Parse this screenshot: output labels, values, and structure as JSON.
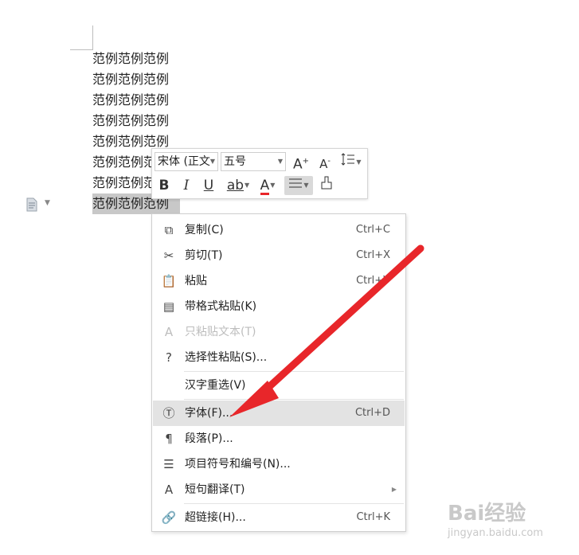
{
  "document": {
    "lines": [
      "范例范例范例",
      "范例范例范例",
      "范例范例范例",
      "范例范例范例",
      "范例范例范例",
      "范例范例范",
      "范例范例范",
      "范例范例范例"
    ]
  },
  "toolbar": {
    "font_name": "宋体 (正文",
    "font_size": "五号",
    "grow_font": "A",
    "shrink_font": "A",
    "bold": "B",
    "italic": "I",
    "underline": "U",
    "highlight": "ab",
    "font_color": "A"
  },
  "menu": {
    "copy": {
      "label": "复制(C)",
      "shortcut": "Ctrl+C"
    },
    "cut": {
      "label": "剪切(T)",
      "shortcut": "Ctrl+X"
    },
    "paste": {
      "label": "粘贴",
      "shortcut": "Ctrl+V"
    },
    "paste_format": {
      "label": "带格式粘贴(K)"
    },
    "paste_text": {
      "label": "只粘贴文本(T)"
    },
    "paste_special": {
      "label": "选择性粘贴(S)..."
    },
    "reconvert": {
      "label": "汉字重选(V)"
    },
    "font": {
      "label": "字体(F)...",
      "shortcut": "Ctrl+D"
    },
    "paragraph": {
      "label": "段落(P)..."
    },
    "bullets": {
      "label": "项目符号和编号(N)..."
    },
    "translate": {
      "label": "短句翻译(T)"
    },
    "hyperlink": {
      "label": "超链接(H)...",
      "shortcut": "Ctrl+K"
    }
  },
  "colors": {
    "arrow": "#e8262a",
    "highlight_row": "#e3e3e3",
    "selection": "#c8c8c8"
  },
  "watermark": {
    "brand": "Bai经验",
    "url": "jingyan.baidu.com"
  }
}
